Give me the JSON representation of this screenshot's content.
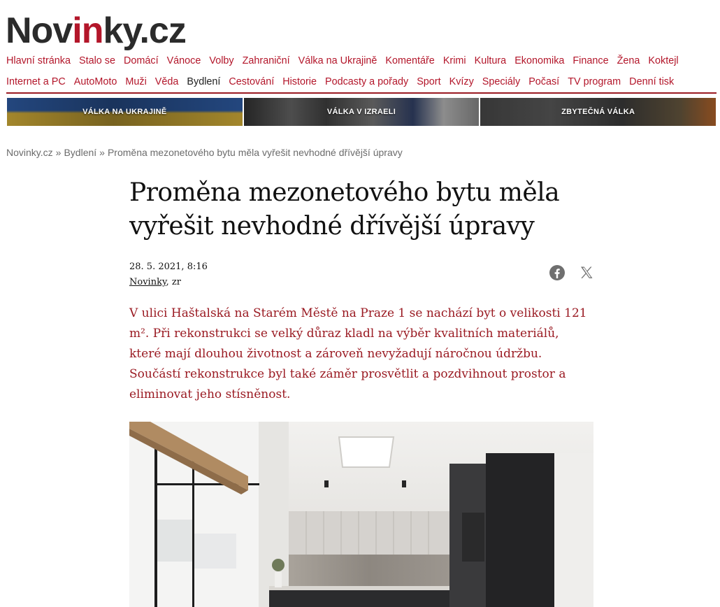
{
  "logo": {
    "prefix": "Nov",
    "accent": "in",
    "suffix": "ky.cz"
  },
  "nav": {
    "row1": [
      {
        "label": "Hlavní stránka"
      },
      {
        "label": "Stalo se"
      },
      {
        "label": "Domácí"
      },
      {
        "label": "Vánoce"
      },
      {
        "label": "Volby"
      },
      {
        "label": "Zahraniční"
      },
      {
        "label": "Válka na Ukrajině"
      },
      {
        "label": "Komentáře"
      },
      {
        "label": "Krimi"
      },
      {
        "label": "Kultura"
      },
      {
        "label": "Ekonomika"
      },
      {
        "label": "Finance"
      },
      {
        "label": "Žena"
      },
      {
        "label": "Koktejl"
      }
    ],
    "row2": [
      {
        "label": "Internet a PC"
      },
      {
        "label": "AutoMoto"
      },
      {
        "label": "Muži"
      },
      {
        "label": "Věda"
      },
      {
        "label": "Bydlení",
        "active": true
      },
      {
        "label": "Cestování"
      },
      {
        "label": "Historie"
      },
      {
        "label": "Podcasty a pořady"
      },
      {
        "label": "Sport"
      },
      {
        "label": "Kvízy"
      },
      {
        "label": "Speciály"
      },
      {
        "label": "Počasí"
      },
      {
        "label": "TV program"
      },
      {
        "label": "Denní tisk"
      }
    ]
  },
  "banners": [
    {
      "label": "VÁLKA NA UKRAJINĚ"
    },
    {
      "label": "VÁLKA V IZRAELI"
    },
    {
      "label": "ZBYTEČNÁ VÁLKA"
    }
  ],
  "breadcrumb": {
    "home": "Novinky.cz",
    "section": "Bydlení",
    "current": "Proměna mezonetového bytu měla vyřešit nevhodné dřívější úpravy",
    "separator": "»"
  },
  "article": {
    "title": "Proměna mezonetového bytu měla vyřešit nevhodné dřívější úpravy",
    "date": "28. 5. 2021, 8:16",
    "source": "Novinky",
    "author_suffix": ", zr",
    "perex": "V ulici Haštalská na Starém Městě na Praze 1 se nachází byt o velikosti 121 m². Při rekonstrukci se velký důraz kladl na výběr kvalitních materiálů, které mají dlouhou životnost a zároveň nevyžadují náročnou údržbu. Součástí rekonstrukce byl také záměr prosvětlit a pozdvihnout prostor a eliminovat jeho stísněnost."
  },
  "share": {
    "icons": [
      "facebook-icon",
      "x-icon"
    ]
  },
  "colors": {
    "accent": "#b3162a",
    "perex": "#9a1a22",
    "text": "#222222",
    "muted": "#6b6b6b"
  }
}
